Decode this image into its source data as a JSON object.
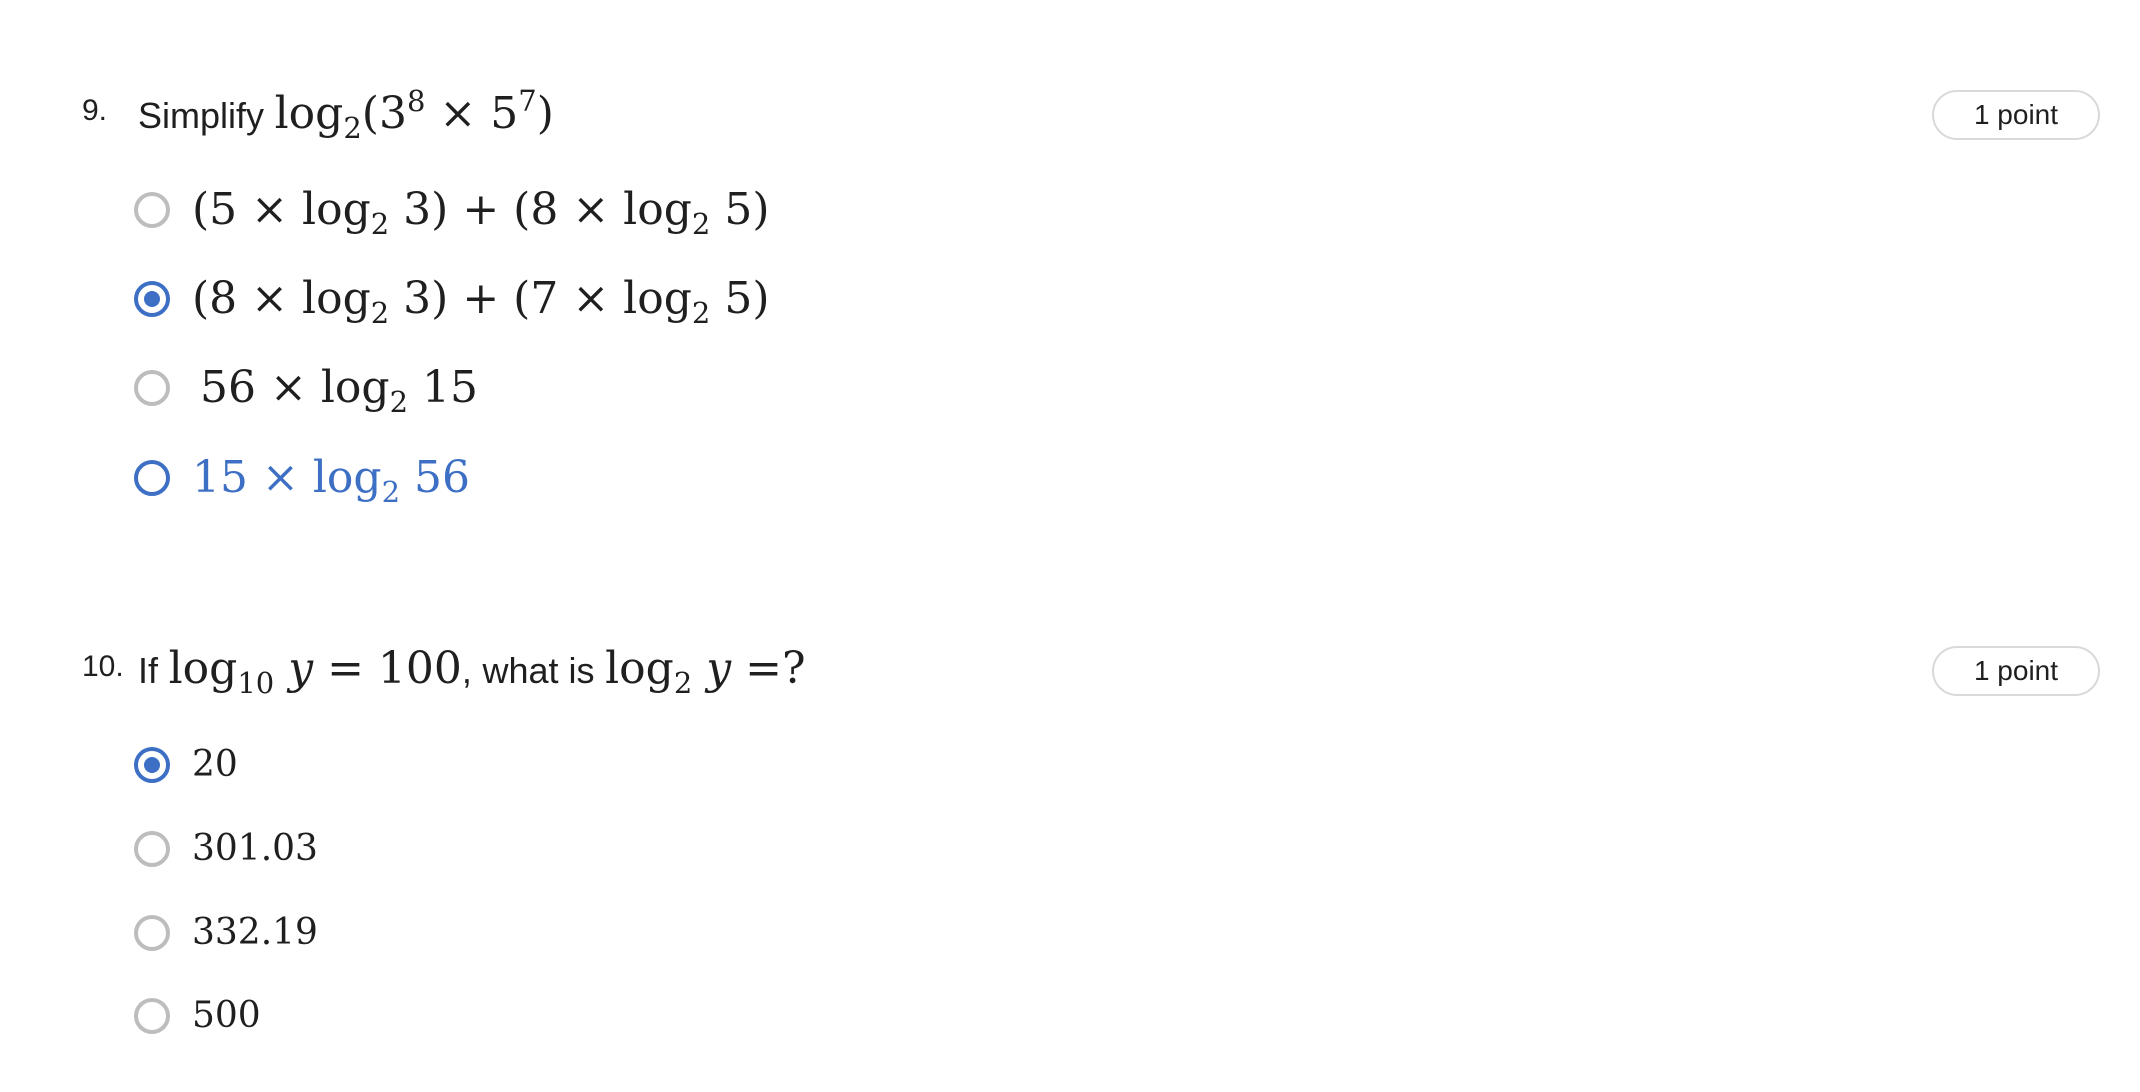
{
  "questions": [
    {
      "number": "9.",
      "prompt_prefix": "Simplify",
      "points": "1 point",
      "options": [
        {
          "label": "(5 × log₂ 3) + (8 × log₂ 5)",
          "state": "unselected"
        },
        {
          "label": "(8 × log₂ 3) + (7 × log₂ 5)",
          "state": "selected"
        },
        {
          "label": "56 × log₂ 15",
          "state": "unselected"
        },
        {
          "label": "15 × log₂ 56",
          "state": "hover"
        }
      ]
    },
    {
      "number": "10.",
      "prompt_parts": [
        "If",
        "what is"
      ],
      "points": "1 point",
      "options": [
        {
          "label": "20",
          "state": "selected"
        },
        {
          "label": "301.03",
          "state": "unselected"
        },
        {
          "label": "332.19",
          "state": "unselected"
        },
        {
          "label": "500",
          "state": "unselected"
        }
      ]
    }
  ],
  "colors": {
    "accent": "#3d6fc4",
    "radio_border": "#bdbdbd",
    "text": "#1f1f1f",
    "badge_border": "#d9d9d9"
  }
}
